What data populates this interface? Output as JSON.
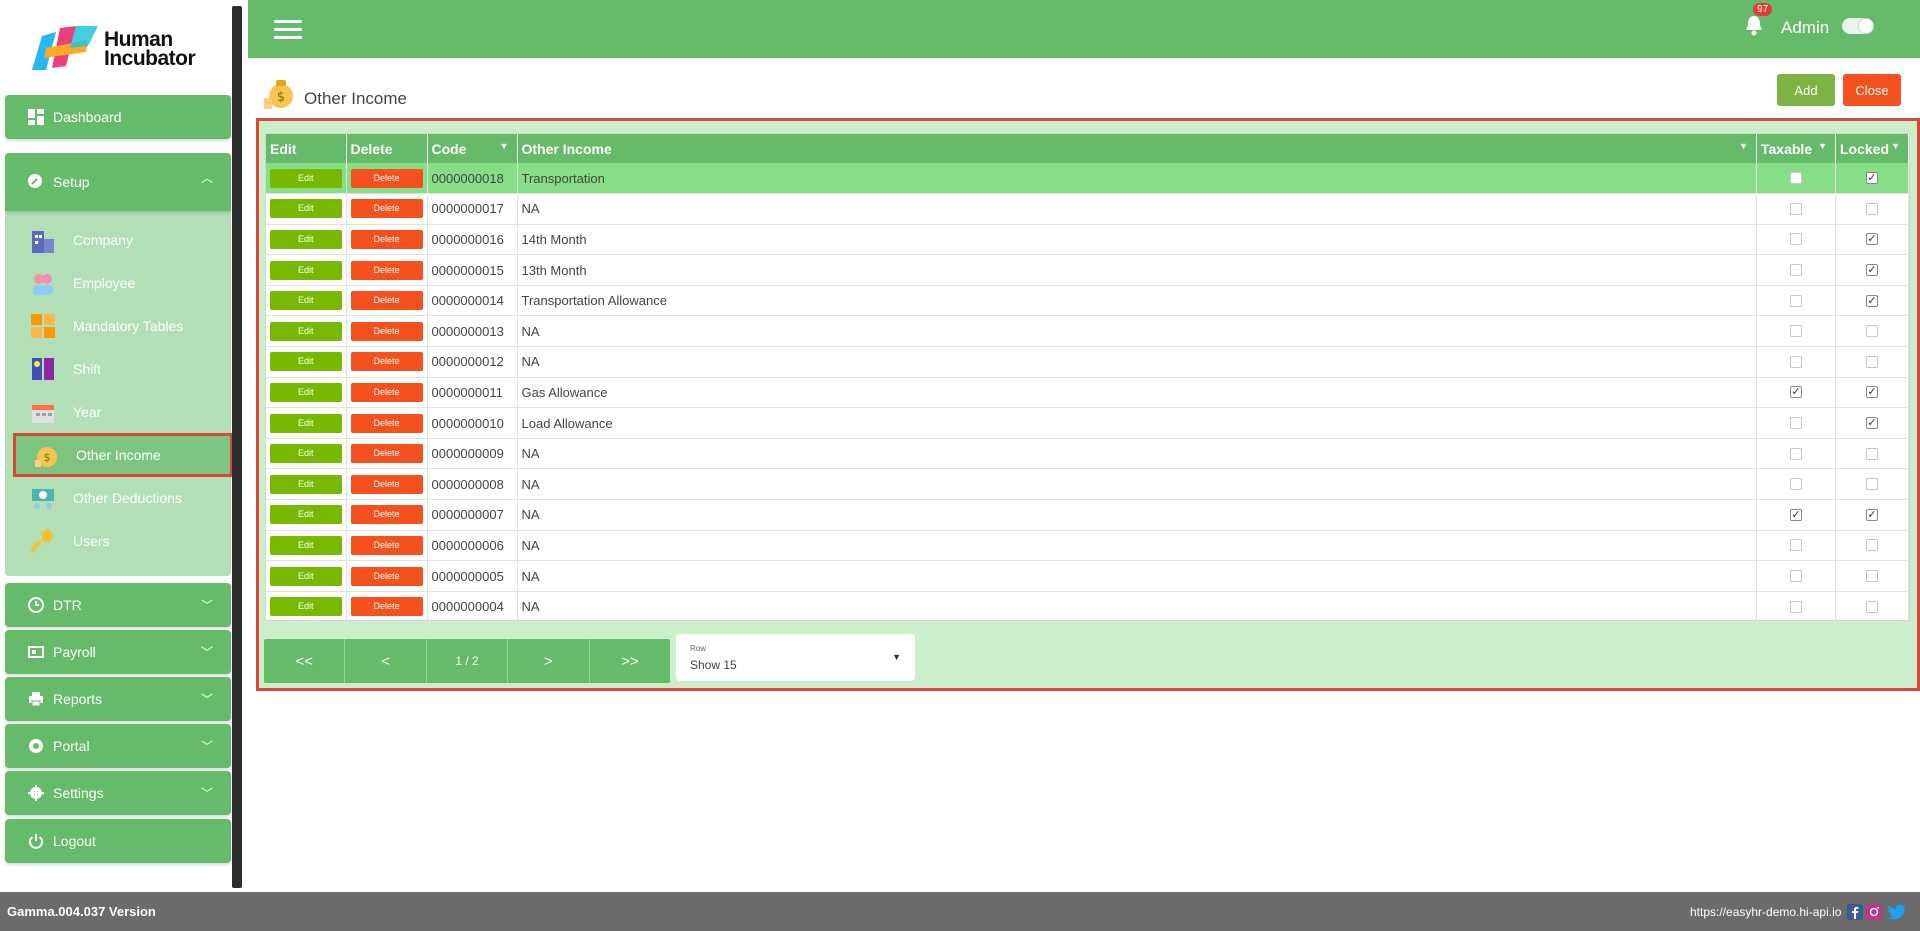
{
  "brand": {
    "line1": "Human",
    "line2": "Incubator"
  },
  "sidebar": {
    "dashboard": "Dashboard",
    "setup": "Setup",
    "setup_items": [
      "Company",
      "Employee",
      "Mandatory Tables",
      "Shift",
      "Year",
      "Other Income",
      "Other Deductions",
      "Users"
    ],
    "dtr": "DTR",
    "payroll": "Payroll",
    "reports": "Reports",
    "portal": "Portal",
    "settings": "Settings",
    "logout": "Logout"
  },
  "header": {
    "notifications": "97",
    "user": "Admin"
  },
  "page": {
    "title": "Other Income",
    "add": "Add",
    "close": "Close"
  },
  "grid": {
    "columns": [
      "Edit",
      "Delete",
      "Code",
      "Other Income",
      "Taxable",
      "Locked"
    ],
    "edit_label": "Edit",
    "delete_label": "Delete",
    "rows": [
      {
        "code": "0000000018",
        "name": "Transportation",
        "taxable": false,
        "locked": true
      },
      {
        "code": "0000000017",
        "name": "NA",
        "taxable": false,
        "locked": false
      },
      {
        "code": "0000000016",
        "name": "14th Month",
        "taxable": false,
        "locked": true
      },
      {
        "code": "0000000015",
        "name": "13th Month",
        "taxable": false,
        "locked": true
      },
      {
        "code": "0000000014",
        "name": "Transportation Allowance",
        "taxable": false,
        "locked": true
      },
      {
        "code": "0000000013",
        "name": "NA",
        "taxable": false,
        "locked": false
      },
      {
        "code": "0000000012",
        "name": "NA",
        "taxable": false,
        "locked": false
      },
      {
        "code": "0000000011",
        "name": "Gas Allowance",
        "taxable": true,
        "locked": true
      },
      {
        "code": "0000000010",
        "name": "Load Allowance",
        "taxable": false,
        "locked": true
      },
      {
        "code": "0000000009",
        "name": "NA",
        "taxable": false,
        "locked": false
      },
      {
        "code": "0000000008",
        "name": "NA",
        "taxable": false,
        "locked": false
      },
      {
        "code": "0000000007",
        "name": "NA",
        "taxable": true,
        "locked": true
      },
      {
        "code": "0000000006",
        "name": "NA",
        "taxable": false,
        "locked": false
      },
      {
        "code": "0000000005",
        "name": "NA",
        "taxable": false,
        "locked": false
      },
      {
        "code": "0000000004",
        "name": "NA",
        "taxable": false,
        "locked": false
      }
    ]
  },
  "pager": {
    "first": "<<",
    "prev": "<",
    "info": "1 / 2",
    "next": ">",
    "last": ">>"
  },
  "row_select": {
    "label": "Row",
    "value": "Show 15"
  },
  "footer": {
    "version": "Gamma.004.037 Version",
    "url": "https://easyhr-demo.hi-api.io"
  },
  "colors": {
    "green": "#66bb6a",
    "light_green": "#b2dfb5",
    "orange": "#f4511e",
    "lime": "#7cb342",
    "highlight": "#d9473a"
  }
}
